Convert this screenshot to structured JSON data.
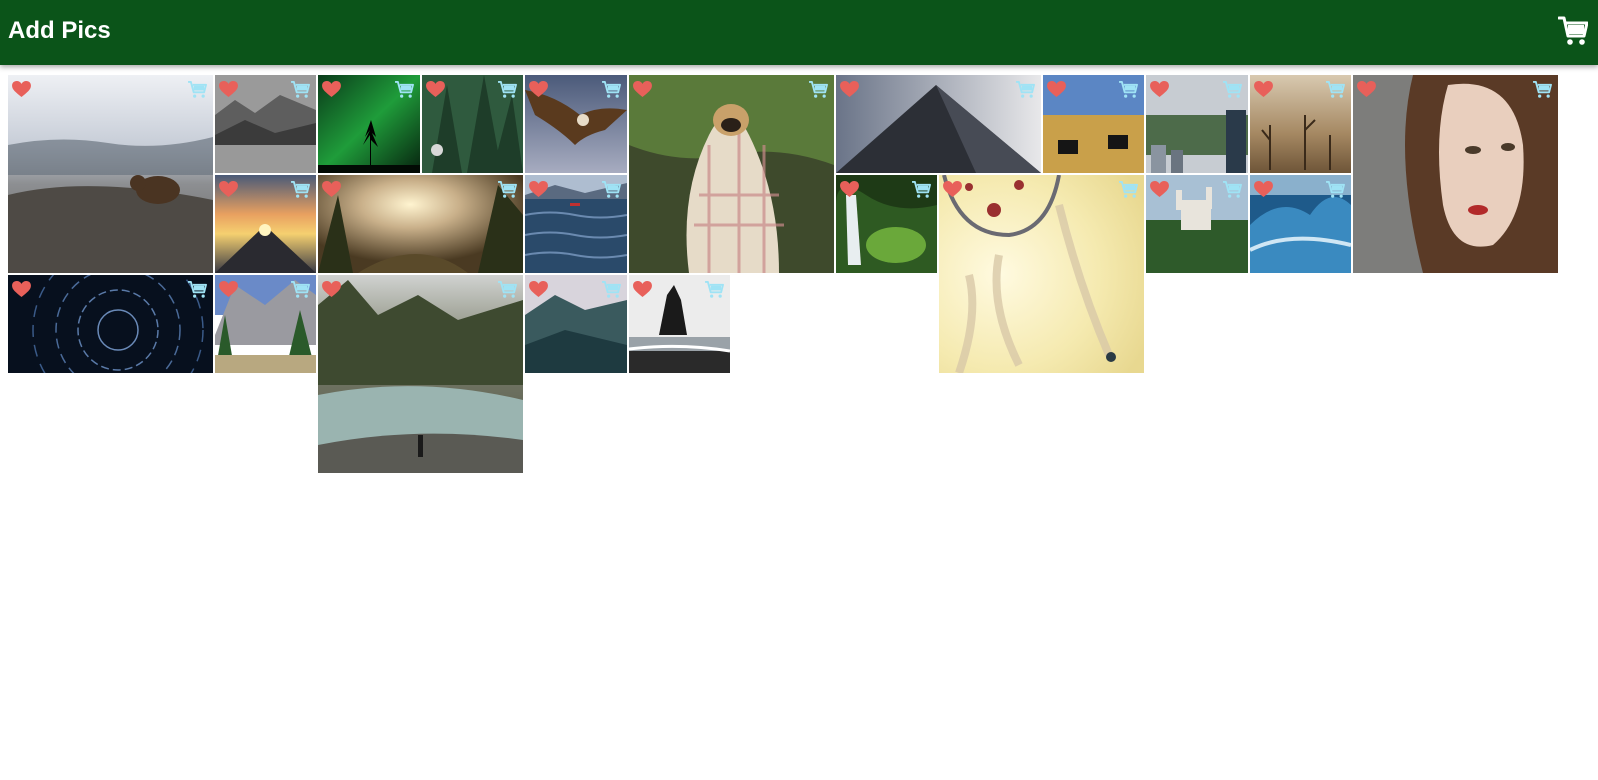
{
  "header": {
    "title": "Add Pics",
    "cart_icon": "shopping-cart-icon",
    "background_color": "#0b5419",
    "title_color": "#ffffff"
  },
  "tile_icons": {
    "favorite": "heart-icon",
    "cart": "shopping-cart-icon",
    "favorite_color": "#e8605a",
    "cart_color": "#9fe3f5"
  },
  "photos": [
    {
      "name": "bear"
    },
    {
      "name": "misty-mountains"
    },
    {
      "name": "aurora"
    },
    {
      "name": "pine-forest"
    },
    {
      "name": "eagle"
    },
    {
      "name": "pug-in-blanket"
    },
    {
      "name": "skyscraper"
    },
    {
      "name": "sneakers-field"
    },
    {
      "name": "city-park"
    },
    {
      "name": "dead-trees"
    },
    {
      "name": "woman-portrait"
    },
    {
      "name": "city-sunset"
    },
    {
      "name": "valley-sunrise"
    },
    {
      "name": "sea-boat"
    },
    {
      "name": "waterfall"
    },
    {
      "name": "dreamcatcher"
    },
    {
      "name": "castle"
    },
    {
      "name": "ocean-wave"
    },
    {
      "name": "star-trails"
    },
    {
      "name": "yosemite"
    },
    {
      "name": "river-hiker"
    },
    {
      "name": "foggy-cliffs"
    },
    {
      "name": "sea-stack"
    }
  ]
}
